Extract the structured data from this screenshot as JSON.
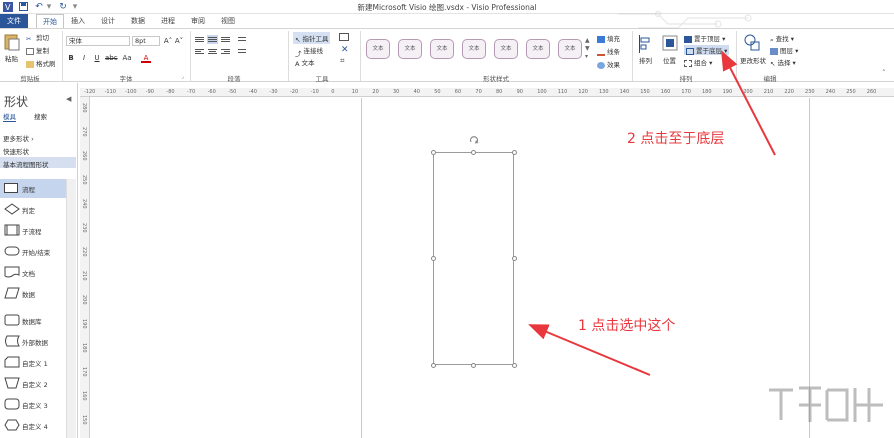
{
  "window": {
    "title": "新建Microsoft Visio 绘图.vsdx - Visio Professional"
  },
  "tabs": [
    {
      "label": "文件"
    },
    {
      "label": "开始"
    },
    {
      "label": "插入"
    },
    {
      "label": "设计"
    },
    {
      "label": "数据"
    },
    {
      "label": "进程"
    },
    {
      "label": "审阅"
    },
    {
      "label": "视图"
    }
  ],
  "ribbon": {
    "clipboard": {
      "paste": "粘贴",
      "cut": "剪切",
      "copy": "复制",
      "format_painter": "格式刷",
      "label": "剪贴板"
    },
    "font": {
      "name": "宋体",
      "size": "8pt",
      "label": "字体",
      "bold": "B",
      "italic": "I",
      "underline": "U",
      "strike": "abc",
      "aa": "Aa",
      "grow": "A˄",
      "shrink": "A˅",
      "color": "A"
    },
    "paragraph": {
      "label": "段落"
    },
    "tools": {
      "pointer": "指针工具",
      "connector": "连接线",
      "text": "文本",
      "label": "工具"
    },
    "shape_styles": {
      "sample": "文本",
      "fill": "填充",
      "line": "线条",
      "effects": "效果",
      "label": "形状样式"
    },
    "arrange": {
      "align": "排列",
      "position": "位置",
      "bring_front": "置于顶层",
      "send_back": "置于底层",
      "group": "组合",
      "label": "排列"
    },
    "editing": {
      "change_shape": "更改形状",
      "find": "查找",
      "layers": "图层",
      "select": "选择",
      "label": "编辑"
    }
  },
  "left_panel": {
    "title": "形状",
    "tab_stencils": "模具",
    "tab_search": "搜索",
    "more_shapes": "更多形状",
    "quick_shapes": "快速形状",
    "basic_flowchart": "基本流程图形状",
    "stencils": [
      {
        "label": "流程"
      },
      {
        "label": "判定"
      },
      {
        "label": "子流程"
      },
      {
        "label": "开始/结束"
      },
      {
        "label": "文档"
      },
      {
        "label": "数据"
      },
      {
        "label": "数据库"
      },
      {
        "label": "外部数据"
      },
      {
        "label": "自定义 1"
      },
      {
        "label": "自定义 2"
      },
      {
        "label": "自定义 3"
      },
      {
        "label": "自定义 4"
      }
    ]
  },
  "ruler": {
    "h_ticks": [
      "-120",
      "-110",
      "-100",
      "-90",
      "-80",
      "-70",
      "-60",
      "-50",
      "-40",
      "-30",
      "-20",
      "-10",
      "0",
      "10",
      "20",
      "30",
      "40",
      "50",
      "60",
      "70",
      "80",
      "90",
      "100",
      "110",
      "120",
      "130",
      "140",
      "150",
      "160",
      "170",
      "180",
      "190",
      "200",
      "210",
      "220",
      "230",
      "240",
      "250",
      "260"
    ],
    "v_ticks": [
      "280",
      "270",
      "260",
      "250",
      "240",
      "230",
      "220",
      "210",
      "200",
      "190",
      "180",
      "170",
      "160",
      "150"
    ]
  },
  "annotations": {
    "step1": "1 点击选中这个",
    "step2": "2 点击至于底层"
  },
  "colors": {
    "accent": "#2b579a",
    "annotation": "#e8383d",
    "selected": "#c5d5ee"
  }
}
